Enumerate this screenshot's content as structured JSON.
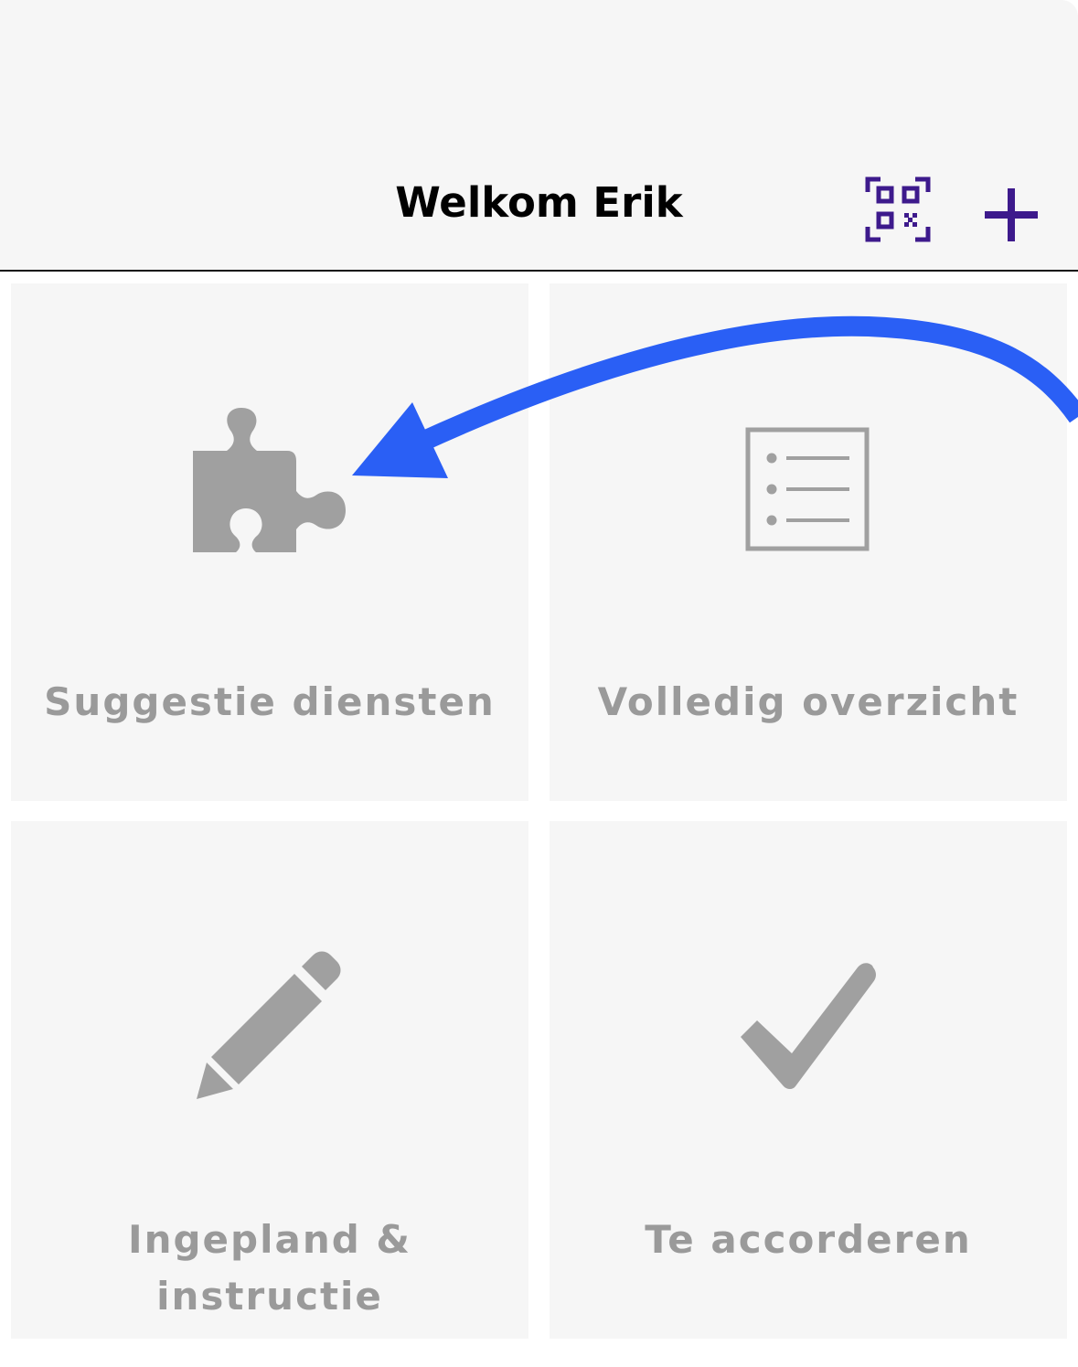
{
  "header": {
    "title": "Welkom Erik",
    "qr_icon": "qr-code-scan-icon",
    "add_icon": "plus-icon",
    "accent_color": "#3d1a8c"
  },
  "tiles": [
    {
      "label": "Suggestie diensten",
      "icon": "puzzle-piece-icon"
    },
    {
      "label": "Volledig overzicht",
      "icon": "list-icon"
    },
    {
      "label": "Ingepland & instructie",
      "icon": "pencil-icon"
    },
    {
      "label": "Te accorderen",
      "icon": "checkmark-icon"
    }
  ],
  "annotation": {
    "arrow_color": "#2a5ff5",
    "icon_color": "#a0a0a0"
  }
}
